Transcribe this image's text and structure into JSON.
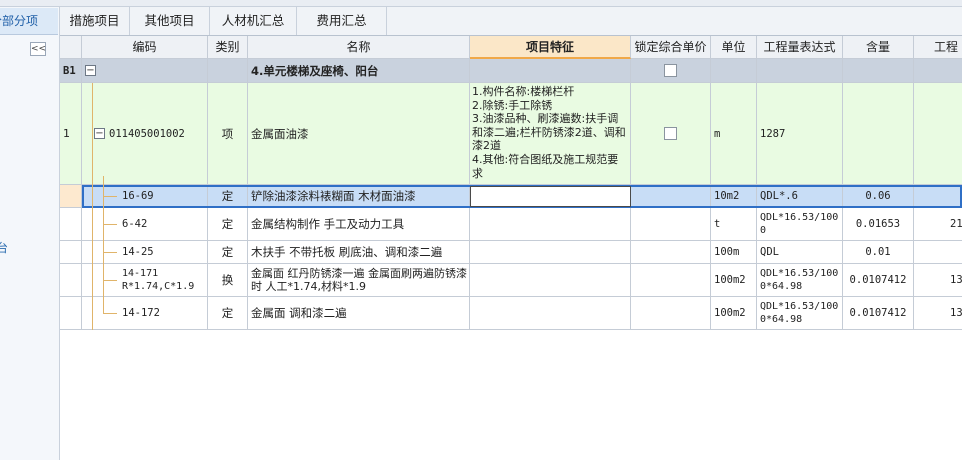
{
  "left_panel": {
    "tab_label": "分部分项",
    "collapse_label": "<<",
    "side_label": "台"
  },
  "tabs": [
    {
      "label": "措施项目"
    },
    {
      "label": "其他项目"
    },
    {
      "label": "人材机汇总"
    },
    {
      "label": "费用汇总"
    }
  ],
  "columns": {
    "code": "编码",
    "type": "类别",
    "name": "名称",
    "feature": "项目特征",
    "lock": "锁定综合单价",
    "unit": "单位",
    "expr": "工程量表达式",
    "content": "含量",
    "qty": "工程"
  },
  "rows": {
    "b1": {
      "index": "B1",
      "name": "4.单元楼梯及座椅、阳台",
      "locked": false
    },
    "item1": {
      "index": "1",
      "code": "011405001002",
      "type": "项",
      "name": "金属面油漆",
      "feature": "1.构件名称:楼梯栏杆\n2.除锈:手工除锈\n3.油漆品种、刷漆遍数:扶手调和漆二遍;栏杆防锈漆2道、调和漆2道\n4.其他:符合图纸及施工规范要求",
      "locked": false,
      "unit": "m",
      "expr": "1287"
    },
    "d1": {
      "code": "16-69",
      "type": "定",
      "name": "铲除油漆涂料裱糊面 木材面油漆",
      "feature": "",
      "unit": "10m2",
      "expr": "QDL*.6",
      "content": "0.06",
      "qty": ""
    },
    "d2": {
      "code": "6-42",
      "type": "定",
      "name": "金属结构制作 手工及动力工具",
      "unit": "t",
      "expr": "QDL*16.53/1000",
      "content": "0.01653",
      "qty": "21"
    },
    "d3": {
      "code": "14-25",
      "type": "定",
      "name": "木扶手 不带托板 刷底油、调和漆二遍",
      "unit": "100m",
      "expr": "QDL",
      "content": "0.01",
      "qty": ""
    },
    "d4": {
      "code": "14-171 R*1.74,C*1.9",
      "type": "换",
      "name": "金属面 红丹防锈漆一遍 金属面刷两遍防锈漆时 人工*1.74,材料*1.9",
      "unit": "100m2",
      "expr": "QDL*16.53/1000*64.98",
      "content": "0.0107412",
      "qty": "13"
    },
    "d5": {
      "code": "14-172",
      "type": "定",
      "name": "金属面 调和漆二遍",
      "unit": "100m2",
      "expr": "QDL*16.53/1000*64.98",
      "content": "0.0107412",
      "qty": "13"
    }
  },
  "colors": {
    "header_feature": "#fbe7c8",
    "group_row": "#c9d2de",
    "item_row": "#e9fbe2",
    "selected_row": "#c8ddf6",
    "tab_active": "#1f5fa8"
  }
}
